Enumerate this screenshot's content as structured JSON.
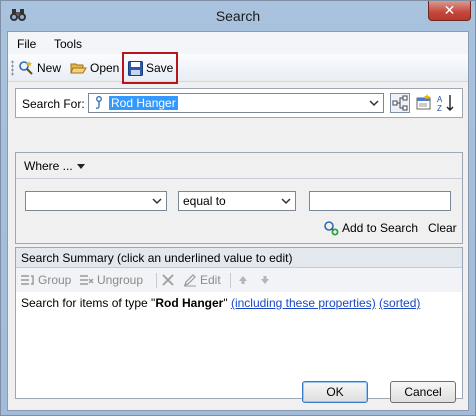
{
  "window": {
    "title": "Search",
    "close_glyph": "✕"
  },
  "menu": {
    "file": "File",
    "tools": "Tools"
  },
  "toolbar": {
    "new_label": "New",
    "open_label": "Open",
    "save_label": "Save"
  },
  "search_for": {
    "label": "Search For:",
    "value": "Rod Hanger"
  },
  "where": {
    "header": "Where ...",
    "property_value": "",
    "operator_value": "equal to",
    "criteria_value": "",
    "add_label": "Add to Search",
    "clear_label": "Clear"
  },
  "summary": {
    "header": "Search Summary (click an underlined value to edit)",
    "group_label": "Group",
    "ungroup_label": "Ungroup",
    "edit_label": "Edit",
    "text_prefix": "Search for items of type \"",
    "type_value": "Rod Hanger",
    "text_quote": "\"",
    "properties_link": "(including these properties)",
    "sorted_link": "(sorted)"
  },
  "buttons": {
    "ok": "OK",
    "cancel": "Cancel"
  },
  "colors": {
    "highlight_border": "#b8141b",
    "selection": "#3399ff",
    "link": "#1a46c5"
  },
  "icons": [
    "binoculars-icon",
    "new-search-icon",
    "open-folder-icon",
    "save-disk-icon",
    "item-type-icon",
    "hierarchy-icon",
    "properties-icon",
    "sort-az-icon",
    "add-search-icon",
    "group-icon",
    "ungroup-icon",
    "delete-icon",
    "edit-icon",
    "move-up-icon",
    "move-down-icon"
  ]
}
